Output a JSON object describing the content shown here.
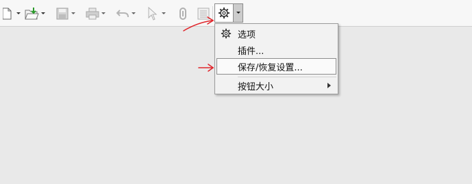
{
  "toolbar": {
    "buttons": [
      "new-file",
      "open",
      "save",
      "print",
      "undo",
      "pointer",
      "attachment",
      "list",
      "settings"
    ]
  },
  "menu": {
    "items": [
      {
        "label": "选项"
      },
      {
        "label": "插件..."
      },
      {
        "label": "保存/恢复设置..."
      },
      {
        "label": "按钮大小"
      }
    ]
  },
  "annotation": {
    "color": "#e0252b"
  }
}
